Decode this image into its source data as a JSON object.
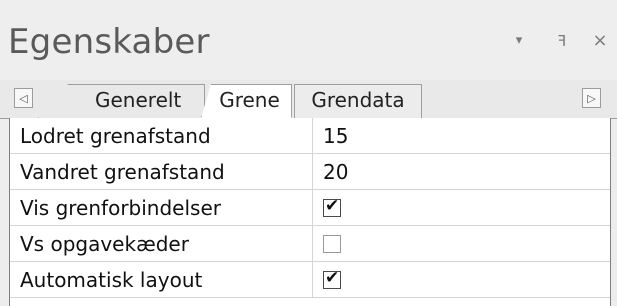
{
  "panel": {
    "title": "Egenskaber",
    "icons": {
      "dropdown": "▾",
      "pin": "ꟻ",
      "close": "×"
    }
  },
  "tabs": {
    "left_arrow": "◁",
    "right_arrow": "▷",
    "items": [
      {
        "label": "Generelt"
      },
      {
        "label": "Grene"
      },
      {
        "label": "Grendata"
      }
    ],
    "active_index": 1
  },
  "properties": [
    {
      "label": "Lodret grenafstand",
      "value": "15",
      "type": "text"
    },
    {
      "label": "Vandret grenafstand",
      "value": "20",
      "type": "text"
    },
    {
      "label": "Vis grenforbindelser",
      "checked": true,
      "type": "checkbox"
    },
    {
      "label": "Vs opgavekæder",
      "checked": false,
      "type": "checkbox"
    },
    {
      "label": "Automatisk layout",
      "checked": true,
      "type": "checkbox"
    }
  ],
  "check_glyph": "✔"
}
